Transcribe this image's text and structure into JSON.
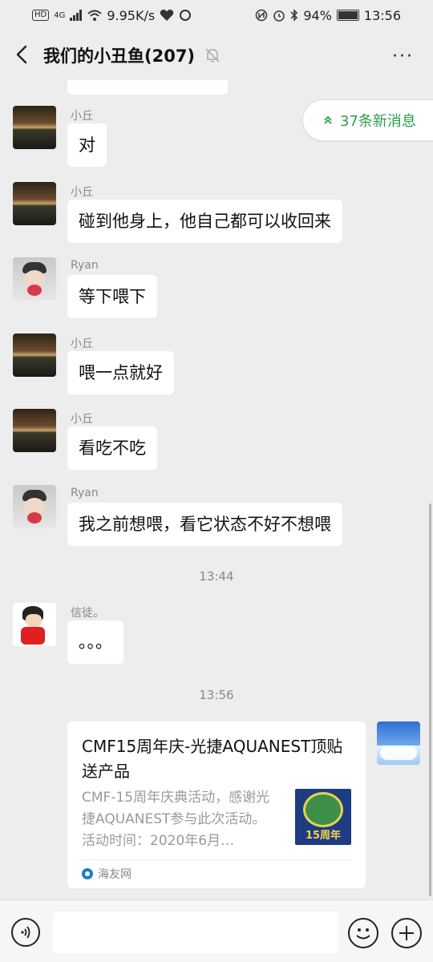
{
  "status_bar": {
    "hd_badge": "HD",
    "network": "4G",
    "speed": "9.95K/s",
    "battery": "94%",
    "time": "13:56"
  },
  "header": {
    "title": "我们的小丑鱼(207)",
    "more": "···"
  },
  "new_messages_pill": {
    "label": "37条新消息",
    "color": "#2a9d4a"
  },
  "messages": [
    {
      "sender": "小丘",
      "text": "对",
      "avatar": "sunset-avatar"
    },
    {
      "sender": "小丘",
      "text": "碰到他身上，他自己都可以收回来",
      "avatar": "sunset-avatar"
    },
    {
      "sender": "Ryan",
      "text": "等下喂下",
      "avatar": "ryan-avatar"
    },
    {
      "sender": "小丘",
      "text": "喂一点就好",
      "avatar": "sunset-avatar"
    },
    {
      "sender": "小丘",
      "text": "看吃不吃",
      "avatar": "sunset-avatar"
    },
    {
      "sender": "Ryan",
      "text": "我之前想喂，看它状态不好不想喂",
      "avatar": "ryan-avatar"
    },
    {
      "sender": "信徒。",
      "text": "。。。",
      "avatar": "cartoon-avatar"
    }
  ],
  "timestamps": [
    "13:44",
    "13:56"
  ],
  "link_card": {
    "title": "CMF15周年庆-光捷AQUANEST顶贴送产品",
    "description": "CMF-15周年庆典活动，感谢光捷AQUANEST参与此次活动。活动时间：2020年6月…",
    "thumb_text": "15周年",
    "source": "海友网"
  },
  "input_bar": {
    "placeholder": ""
  }
}
